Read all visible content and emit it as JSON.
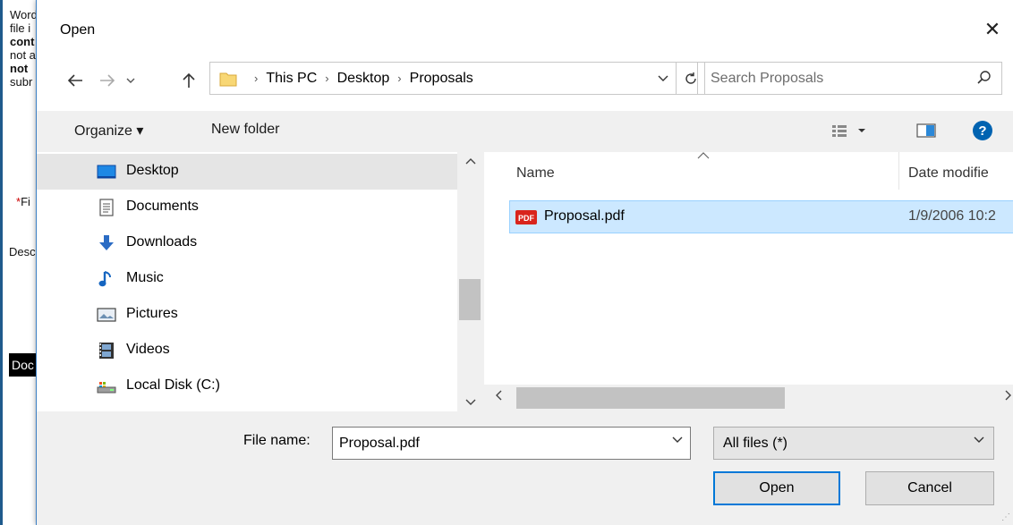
{
  "background_page": {
    "lines": [
      "Word",
      "file i",
      "cont",
      "not a",
      "not",
      "subr"
    ],
    "required_mark_1": "*",
    "file_label": "Fi",
    "desc_label": "Desc",
    "doc_button": "Doc"
  },
  "dialog": {
    "title": "Open",
    "close_glyph": "✕"
  },
  "address_bar": {
    "crumbs": [
      "This PC",
      "Desktop",
      "Proposals"
    ],
    "separator": "›"
  },
  "search": {
    "placeholder": "Search Proposals"
  },
  "toolbar": {
    "organize_label": "Organize ▾",
    "new_folder_label": "New folder"
  },
  "nav_pane": {
    "items": [
      {
        "label": "Desktop",
        "icon": "desktop-icon",
        "selected": true
      },
      {
        "label": "Documents",
        "icon": "documents-icon",
        "selected": false
      },
      {
        "label": "Downloads",
        "icon": "downloads-icon",
        "selected": false
      },
      {
        "label": "Music",
        "icon": "music-icon",
        "selected": false
      },
      {
        "label": "Pictures",
        "icon": "pictures-icon",
        "selected": false
      },
      {
        "label": "Videos",
        "icon": "videos-icon",
        "selected": false
      },
      {
        "label": "Local Disk (C:)",
        "icon": "local-disk-icon",
        "selected": false
      }
    ]
  },
  "file_list": {
    "columns": [
      "Name",
      "Date modifie"
    ],
    "files": [
      {
        "name": "Proposal.pdf",
        "date": "1/9/2006 10:2",
        "selected": true
      }
    ]
  },
  "bottom": {
    "file_name_label": "File name:",
    "file_name_value": "Proposal.pdf",
    "file_type_value": "All files (*)",
    "open_label": "Open",
    "cancel_label": "Cancel"
  },
  "colors": {
    "accent": "#0078d7",
    "selection": "#cce8ff",
    "help": "#0063b1"
  }
}
